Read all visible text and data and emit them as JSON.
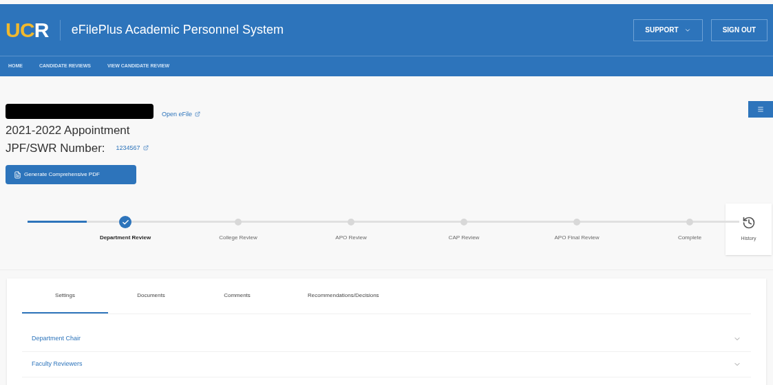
{
  "header": {
    "logo": [
      {
        "text": "UC",
        "color": "#f1b92d"
      },
      {
        "text": "R",
        "color": "#ffffff"
      }
    ],
    "title": "eFilePlus Academic Personnel System",
    "buttons": [
      {
        "label": "SUPPORT",
        "dropdown": true
      },
      {
        "label": "SIGN OUT",
        "dropdown": false
      }
    ]
  },
  "breadcrumbs": [
    "HOME",
    "CANDIDATE REVIEWS",
    "VIEW CANDIDATE REVIEW"
  ],
  "candidate": {
    "open_link": "Open eFile",
    "title": "2021-2022 Appointment",
    "number_label": "JPF/SWR Number:",
    "number": "1234567",
    "pdf_button": "Generate Comprehensive PDF"
  },
  "steps": [
    {
      "label": "Department Review",
      "selected": true
    },
    {
      "label": "College Review",
      "selected": false
    },
    {
      "label": "APO Review",
      "selected": false
    },
    {
      "label": "CAP Review",
      "selected": false
    },
    {
      "label": "APO Final Review",
      "selected": false
    },
    {
      "label": "Complete",
      "selected": false
    }
  ],
  "history_button": "History",
  "tabs": [
    {
      "label": "Settings",
      "selected": true
    },
    {
      "label": "Documents",
      "selected": false
    },
    {
      "label": "Comments",
      "selected": false
    },
    {
      "label": "Recommendations/Decisions",
      "selected": false
    }
  ],
  "sections": [
    {
      "label": "Department Chair",
      "expanded": false
    },
    {
      "label": "Faculty Reviewers",
      "expanded": false
    }
  ]
}
